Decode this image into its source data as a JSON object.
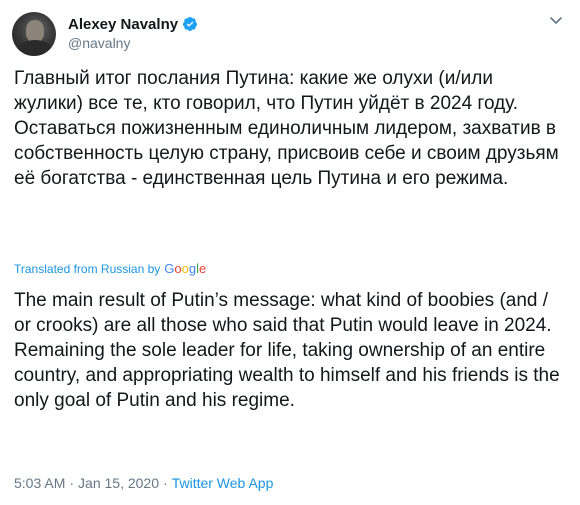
{
  "author": {
    "display_name": "Alexey Navalny",
    "handle": "@navalny",
    "verified_icon": "verified-badge-icon",
    "verified_color": "#1da1f2"
  },
  "tweet": {
    "original_text": "Главный итог послания Путина: какие же олухи (и/или жулики) все те, кто говорил, что Путин уйдёт в 2024 году. Оставаться пожизненным единоличным лидером, захватив в собственность целую страну, присвоив себе и своим друзьям её богатства - единственная цель Путина и его режима.",
    "translation_label": "Translated from Russian by",
    "translation_provider": {
      "g1": "G",
      "o1": "o",
      "o2": "o",
      "g2": "g",
      "l": "l",
      "e": "e"
    },
    "translated_text": "The main result of Putin’s message: what kind of boobies (and / or crooks) are all those who said that Putin would leave in 2024. Remaining the sole leader for life, taking ownership of an entire country, and appropriating wealth to himself and his friends is the only goal of Putin and his regime.",
    "time": "5:03 AM",
    "date": "Jan 15, 2020",
    "separator": "·",
    "source": "Twitter Web App"
  },
  "colors": {
    "link": "#1b95e0",
    "secondary_text": "#657786",
    "primary_text": "#14171a"
  }
}
